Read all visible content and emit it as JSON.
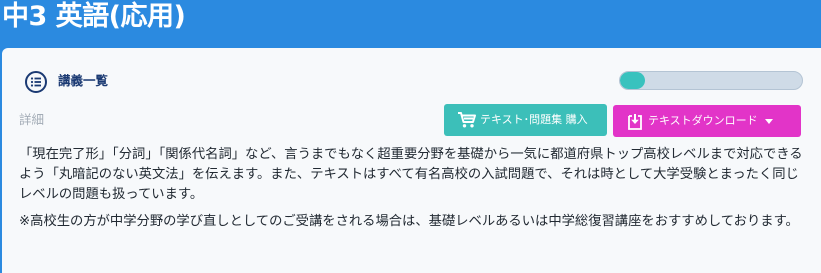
{
  "header": {
    "title": "中3 英語(応用)"
  },
  "lecture": {
    "label": "講義一覧",
    "progress": 0.14
  },
  "detail": {
    "label": "詳細"
  },
  "buttons": {
    "purchase_label": "テキスト･問題集 購入",
    "download_label": "テキストダウンロード"
  },
  "description": {
    "paragraph1": "「現在完了形」「分詞」「関係代名詞」など、言うまでもなく超重要分野を基礎から一気に都道府県トップ高校レベルまで対応できるよう「丸暗記のない英文法」を伝えます。また、テキストはすべて有名高校の入試問題で、それは時として大学受験とまったく同じレベルの問題も扱っています。",
    "paragraph2": "※高校生の方が中学分野の学び直しとしてのご受講をされる場合は、基礎レベルあるいは中学総復習講座をおすすめしております。"
  },
  "colors": {
    "header_bg": "#2b8ae0",
    "progress_fill": "#39c2be",
    "purchase_button": "#3cbfb9",
    "download_button": "#e234c8",
    "lecture_label": "#1b3a73"
  },
  "icons": [
    "list-icon",
    "cart-icon",
    "download-icon",
    "caret-down-icon"
  ]
}
